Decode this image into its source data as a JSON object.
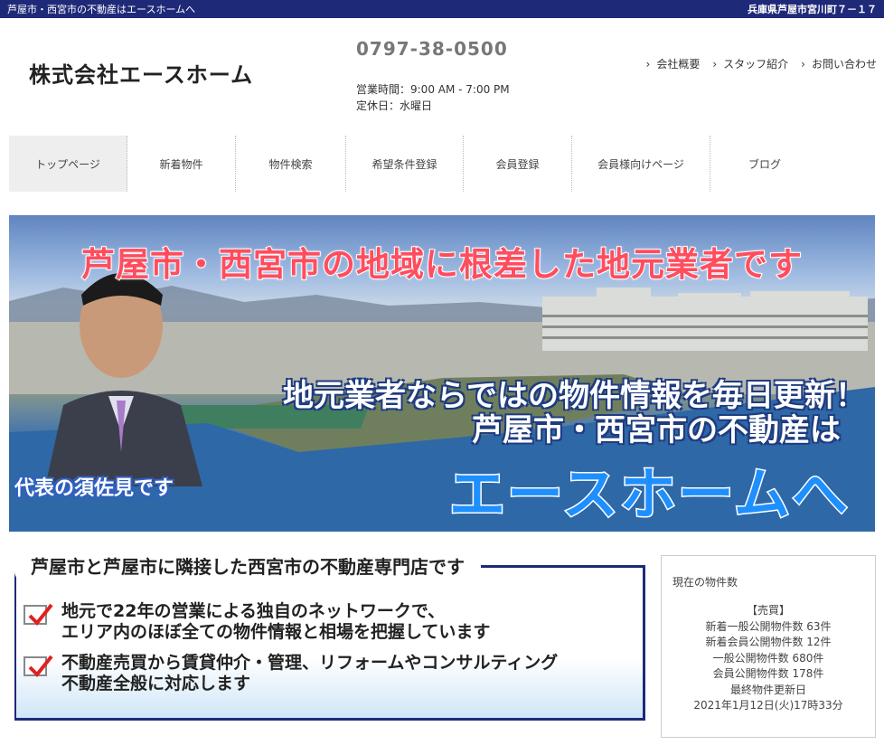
{
  "topbar": {
    "left": "芦屋市・西宮市の不動産はエースホームへ",
    "right": "兵庫県芦屋市宮川町７－１７"
  },
  "header": {
    "company": "株式会社エースホーム",
    "phone": "0797-38-0500",
    "hours": "営業時間：9:00 AM - 7:00 PM",
    "closed": "定休日：水曜日",
    "links": [
      "会社概要",
      "スタッフ紹介",
      "お問い合わせ"
    ]
  },
  "nav": [
    "トップページ",
    "新着物件",
    "物件検索",
    "希望条件登録",
    "会員登録",
    "会員様向けページ",
    "ブログ"
  ],
  "hero": {
    "title": "芦屋市・西宮市の地域に根差した地元業者です",
    "line1": "地元業者ならではの物件情報を毎日更新！",
    "line2": "芦屋市・西宮市の不動産は",
    "brand": "エースホームへ",
    "rep": "代表の須佐見です"
  },
  "info": {
    "heading": "芦屋市と芦屋市に隣接した西宮市の不動産専門店です",
    "items": [
      {
        "l1": "地元で22年の営業による独自のネットワークで、",
        "l2": "エリア内のほぼ全ての物件情報と相場を把握しています"
      },
      {
        "l1": "不動産売買から賃貸仲介・管理、リフォームやコンサルティング",
        "l2": "不動産全般に対応します"
      }
    ]
  },
  "side": {
    "title": "現在の物件数",
    "section": "【売買】",
    "rows": [
      "新着一般公開物件数 63件",
      "新着会員公開物件数 12件",
      "一般公開物件数 680件",
      "会員公開物件数 178件",
      "最終物件更新日",
      "2021年1月12日(火)17時33分"
    ]
  },
  "colors": {
    "topbar": "#1e2a78",
    "accent_red": "#ff4d5e",
    "brand_blue": "#1e8fff"
  }
}
